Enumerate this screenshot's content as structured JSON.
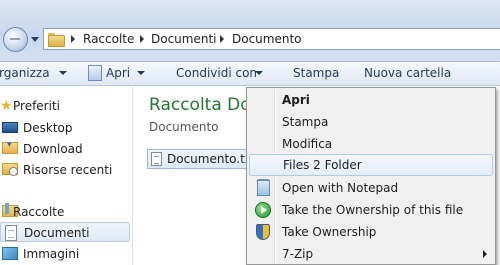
{
  "address_bar": {
    "crumbs": [
      "Raccolte",
      "Documenti",
      "Documento"
    ]
  },
  "command_bar": {
    "organize": "rganizza",
    "open": "Apri",
    "share": "Condividi con",
    "print": "Stampa",
    "new_folder": "Nuova cartella"
  },
  "nav_pane": {
    "favorites": "Preferiti",
    "desktop": "Desktop",
    "downloads": "Download",
    "recent": "Risorse recenti",
    "libraries": "Raccolte",
    "documents": "Documenti",
    "images": "Immagini"
  },
  "content": {
    "library_title": "Raccolta Do",
    "library_subtitle": "Documento",
    "file_name": "Documento.txt"
  },
  "context_menu": {
    "items": [
      "Apri",
      "Stampa",
      "Modifica",
      "Files 2 Folder",
      "Open with Notepad",
      "Take the Ownership of this file",
      "Take Ownership",
      "7-Zip"
    ]
  }
}
